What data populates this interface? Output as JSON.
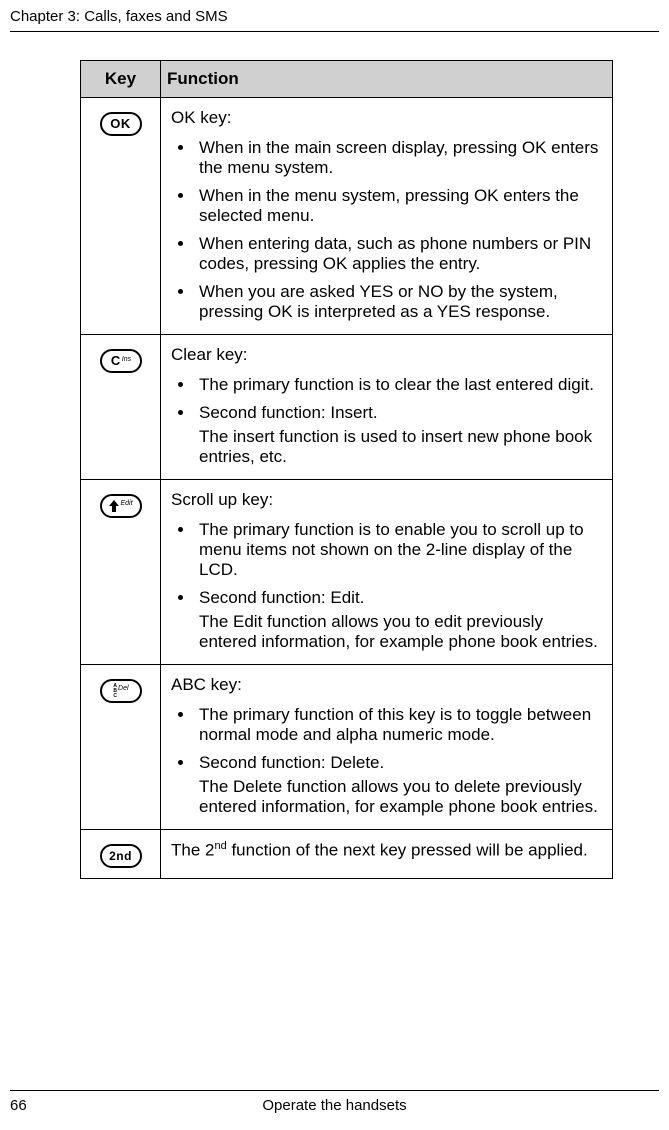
{
  "header": {
    "chapter_line": "Chapter 3:  Calls, faxes and SMS"
  },
  "table": {
    "head": {
      "key": "Key",
      "func": "Function"
    },
    "rows": [
      {
        "key_label_big": "OK",
        "key_label_sup": "",
        "title": "OK key:",
        "bullets": [
          {
            "main": "When in the main screen display, pressing OK enters the menu system."
          },
          {
            "main": "When in the menu system, pressing OK enters the selected menu."
          },
          {
            "main": "When entering data, such as phone numbers or PIN codes, pressing OK applies the entry."
          },
          {
            "main": "When you are asked YES or NO by the system, pressing OK is interpreted as a YES response."
          }
        ]
      },
      {
        "key_label_big": "C",
        "key_label_sup": "Ins",
        "title": "Clear key:",
        "bullets": [
          {
            "main": "The primary function is to clear the last entered digit."
          },
          {
            "main": "Second function: Insert.",
            "sub": "The insert function is used to insert new phone book entries, etc."
          }
        ]
      },
      {
        "key_label_sup": "Edit",
        "title": "Scroll up key:",
        "bullets": [
          {
            "main": "The primary function is to enable you to scroll up to menu items not shown on the 2-line display of the LCD."
          },
          {
            "main": "Second function: Edit.",
            "sub": "The Edit function allows you to edit previously entered information, for example phone book entries."
          }
        ]
      },
      {
        "key_label_sup": "Del",
        "title": "ABC key:",
        "bullets": [
          {
            "main": "The primary function of this key is to toggle between normal mode and alpha numeric mode."
          },
          {
            "main": "Second function: Delete.",
            "sub": "The Delete function allows you to delete previously entered information, for example phone book entries."
          }
        ]
      },
      {
        "key_label_big": "2nd",
        "plain_pre": "The 2",
        "plain_sup": "nd",
        "plain_post": " function of the next key pressed will be applied."
      }
    ]
  },
  "footer": {
    "page": "66",
    "title": "Operate the handsets"
  }
}
